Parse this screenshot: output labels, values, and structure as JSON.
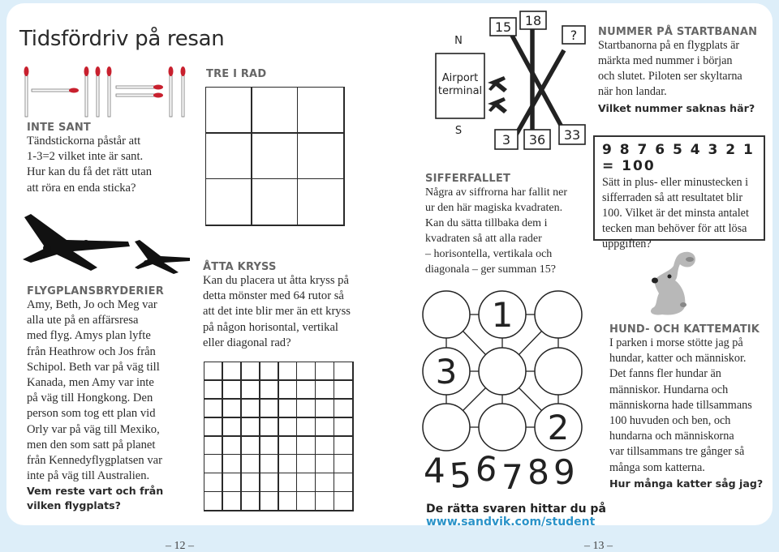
{
  "page_title": "Tidsfördriv på resan",
  "matchsticks": {
    "equation_shown": "1-3=2"
  },
  "inte_sant": {
    "heading": "INTE SANT",
    "lines": [
      "Tändstickorna påstår att",
      "1-3=2 vilket inte är sant.",
      "Hur kan du få det rätt utan",
      "att röra en enda sticka?"
    ]
  },
  "flygplans": {
    "heading": "FLYGPLANSBRYDERIER",
    "lines": [
      "Amy, Beth, Jo och Meg var",
      "alla ute på en affärsresa",
      "med flyg. Amys plan lyfte",
      "från Heathrow och Jos från",
      "Schipol. Beth var på väg till",
      "Kanada, men Amy var inte",
      "på väg till Hongkong. Den",
      "person som tog ett plan vid",
      "Orly var på väg till Mexiko,",
      "men den som satt på planet",
      "från Kennedyflygplatsen var",
      "inte på väg till Australien."
    ],
    "question_lines": [
      "Vem reste vart och från",
      "vilken flygplats?"
    ]
  },
  "tre_i_rad": {
    "heading": "TRE I RAD",
    "grid_size": 3
  },
  "atta_kryss": {
    "heading": "ÅTTA KRYSS",
    "lines": [
      "Kan du placera ut åtta kryss på",
      "detta mönster med 64 rutor så",
      "att det inte blir mer än ett kryss",
      "på någon horisontal, vertikal",
      "eller diagonal rad?"
    ],
    "grid_size": 8
  },
  "runway": {
    "north": "N",
    "south": "S",
    "terminal_line1": "Airport",
    "terminal_line2": "terminal",
    "signs": {
      "top_left": "15",
      "top_middle": "18",
      "top_right": "?",
      "bottom_left": "3",
      "bottom_middle": "36",
      "bottom_right": "33"
    }
  },
  "nummer": {
    "heading": "NUMMER PÅ STARTBANAN",
    "lines": [
      "Startbanorna på en flygplats är",
      "märkta med nummer i början",
      "och slutet. Piloten ser skyltarna",
      "när hon landar."
    ],
    "question": "Vilket nummer saknas här?"
  },
  "sifferfallet": {
    "heading": "SIFFERFALLET",
    "lines": [
      "Några av siffrorna har fallit ner",
      "ur den här magiska kvadraten.",
      "Kan du sätta tillbaka dem i",
      "kvadraten så att alla rader",
      "– horisontella, vertikala och",
      "diagonala – ger summan 15?"
    ],
    "cells": [
      "",
      "1",
      "",
      "3",
      "",
      "",
      "",
      "",
      "2"
    ],
    "fallen_digits": [
      "4",
      "5",
      "6",
      "7",
      "8",
      "9"
    ]
  },
  "siffer_box": {
    "equation": "9 8 7 6 5 4 3 2 1 = 100",
    "lines": [
      "Sätt in plus- eller minustecken i",
      "sifferraden så att resultatet blir",
      "100. Vilket är det minsta antalet",
      "tecken man behöver för att lösa",
      "uppgiften?"
    ]
  },
  "hund": {
    "heading": "HUND- OCH KATTEMATIK",
    "lines": [
      "I parken i morse stötte jag på",
      "hundar, katter och människor.",
      "Det fanns fler hundar än",
      "människor. Hundarna och",
      "människorna hade tillsammans",
      "100 huvuden och ben, och",
      "hundarna och människorna",
      "var tillsammans tre gånger så",
      "många som katterna."
    ],
    "question": "Hur många katter såg jag?"
  },
  "footer": {
    "text": "De rätta svaren hittar du på ",
    "link": "www.sandvik.com/student",
    "link_color": "#2a93c9"
  },
  "page_numbers": {
    "left": "– 12 –",
    "right": "– 13 –"
  },
  "colors": {
    "background": "#ddeef9",
    "heading_gray": "#666666",
    "match_head": "#c8202e"
  }
}
